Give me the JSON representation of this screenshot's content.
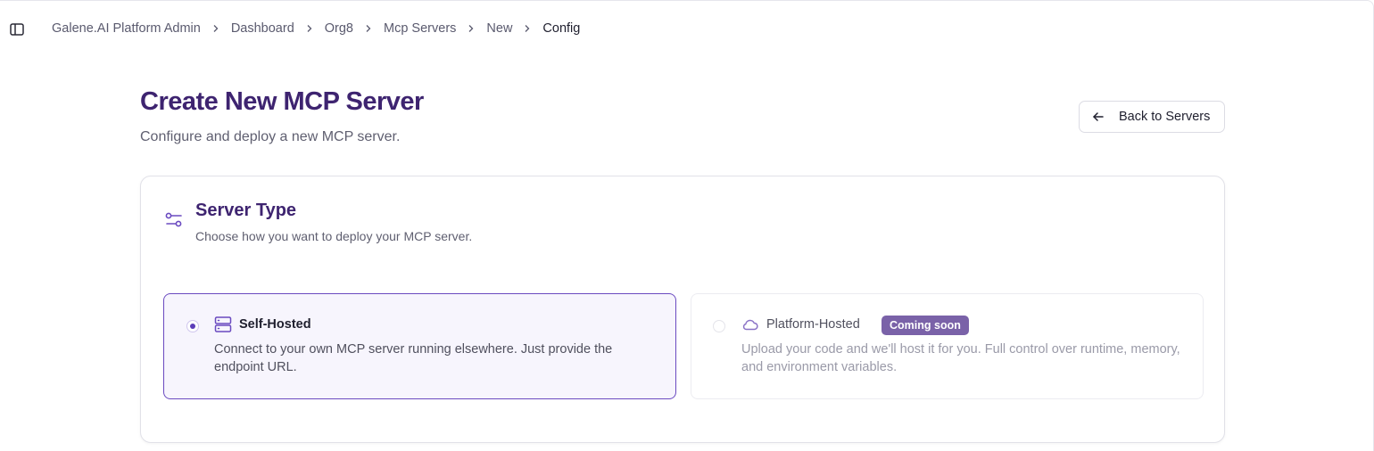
{
  "breadcrumb": {
    "items": [
      "Galene.AI Platform Admin",
      "Dashboard",
      "Org8",
      "Mcp Servers",
      "New",
      "Config"
    ]
  },
  "icons": {
    "sidebar_toggle": "sidebar-toggle-icon",
    "chevron": "chevron-right-icon",
    "back": "arrow-left-icon",
    "server_type": "sliders-icon",
    "self_hosted": "server-icon",
    "platform_hosted": "cloud-icon"
  },
  "page": {
    "title": "Create New MCP Server",
    "subtitle": "Configure and deploy a new MCP server.",
    "back_button_label": "Back to Servers"
  },
  "server_type": {
    "title": "Server Type",
    "subtitle": "Choose how you want to deploy your MCP server.",
    "options": [
      {
        "label": "Self-Hosted",
        "description": "Connect to your own MCP server running elsewhere. Just provide the endpoint URL.",
        "selected": true,
        "badge": ""
      },
      {
        "label": "Platform-Hosted",
        "description": "Upload your code and we'll host it for you. Full control over runtime, memory, and environment variables.",
        "selected": false,
        "badge": "Coming soon"
      }
    ]
  },
  "colors": {
    "accent": "#3e2470",
    "selected_border": "#6a4ac0",
    "selected_bg": "#f7f5fd",
    "badge_bg": "#7a62a8"
  }
}
